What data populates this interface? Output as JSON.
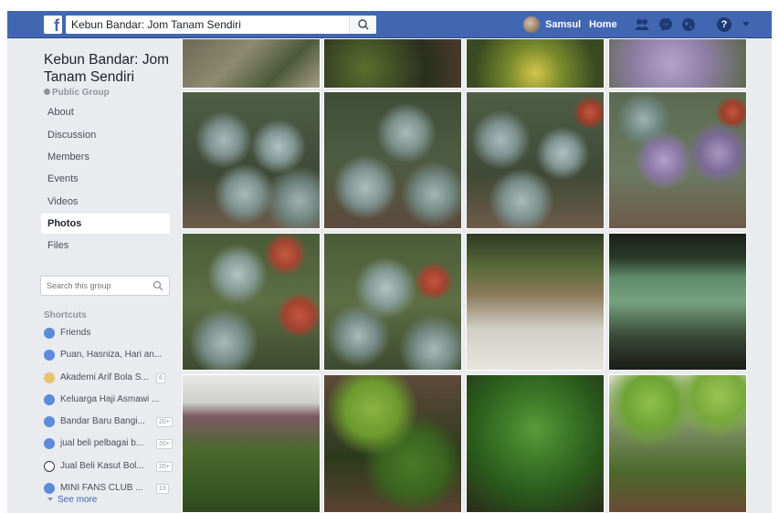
{
  "topbar": {
    "logo": "f",
    "search_value": "Kebun Bandar: Jom Tanam Sendiri",
    "user_name": "Samsul",
    "home_label": "Home",
    "help_label": "?"
  },
  "sidebar": {
    "group_name": "Kebun Bandar: Jom Tanam Sendiri",
    "group_type": "Public Group",
    "nav": [
      {
        "label": "About"
      },
      {
        "label": "Discussion"
      },
      {
        "label": "Members"
      },
      {
        "label": "Events"
      },
      {
        "label": "Videos"
      },
      {
        "label": "Photos",
        "active": true
      },
      {
        "label": "Files"
      }
    ],
    "search_placeholder": "Search this group",
    "shortcuts_title": "Shortcuts",
    "shortcuts": [
      {
        "label": "Friends",
        "badge": ""
      },
      {
        "label": "Puan, Hasniza, Hari an...",
        "badge": ""
      },
      {
        "label": "Akademi Arif Bola S...",
        "badge": "6"
      },
      {
        "label": "Keluarga Haji Asmawi ...",
        "badge": ""
      },
      {
        "label": "Bandar Baru Bangi...",
        "badge": "20+"
      },
      {
        "label": "jual beli pelbagai b...",
        "badge": "20+"
      },
      {
        "label": "Jual Beli Kasut Bol...",
        "badge": "20+"
      },
      {
        "label": "MINI FANS CLUB ...",
        "badge": "13"
      }
    ],
    "see_more": "See more"
  },
  "colors": {
    "brand": "#4267b2",
    "background": "#e9ebee",
    "text": "#1d2129",
    "muted": "#90949c"
  },
  "photos": [
    {
      "subject": "garden tree"
    },
    {
      "subject": "plant pots"
    },
    {
      "subject": "yellow flowers"
    },
    {
      "subject": "purple cabbage"
    },
    {
      "subject": "ornamental cabbage"
    },
    {
      "subject": "ornamental cabbage"
    },
    {
      "subject": "ornamental cabbage"
    },
    {
      "subject": "purple cabbage"
    },
    {
      "subject": "cabbage pots"
    },
    {
      "subject": "cabbage pots"
    },
    {
      "subject": "balcony garden"
    },
    {
      "subject": "seedlings in jars"
    },
    {
      "subject": "garden with house"
    },
    {
      "subject": "potted leaves"
    },
    {
      "subject": "green herbs"
    },
    {
      "subject": "potted leaves"
    }
  ]
}
